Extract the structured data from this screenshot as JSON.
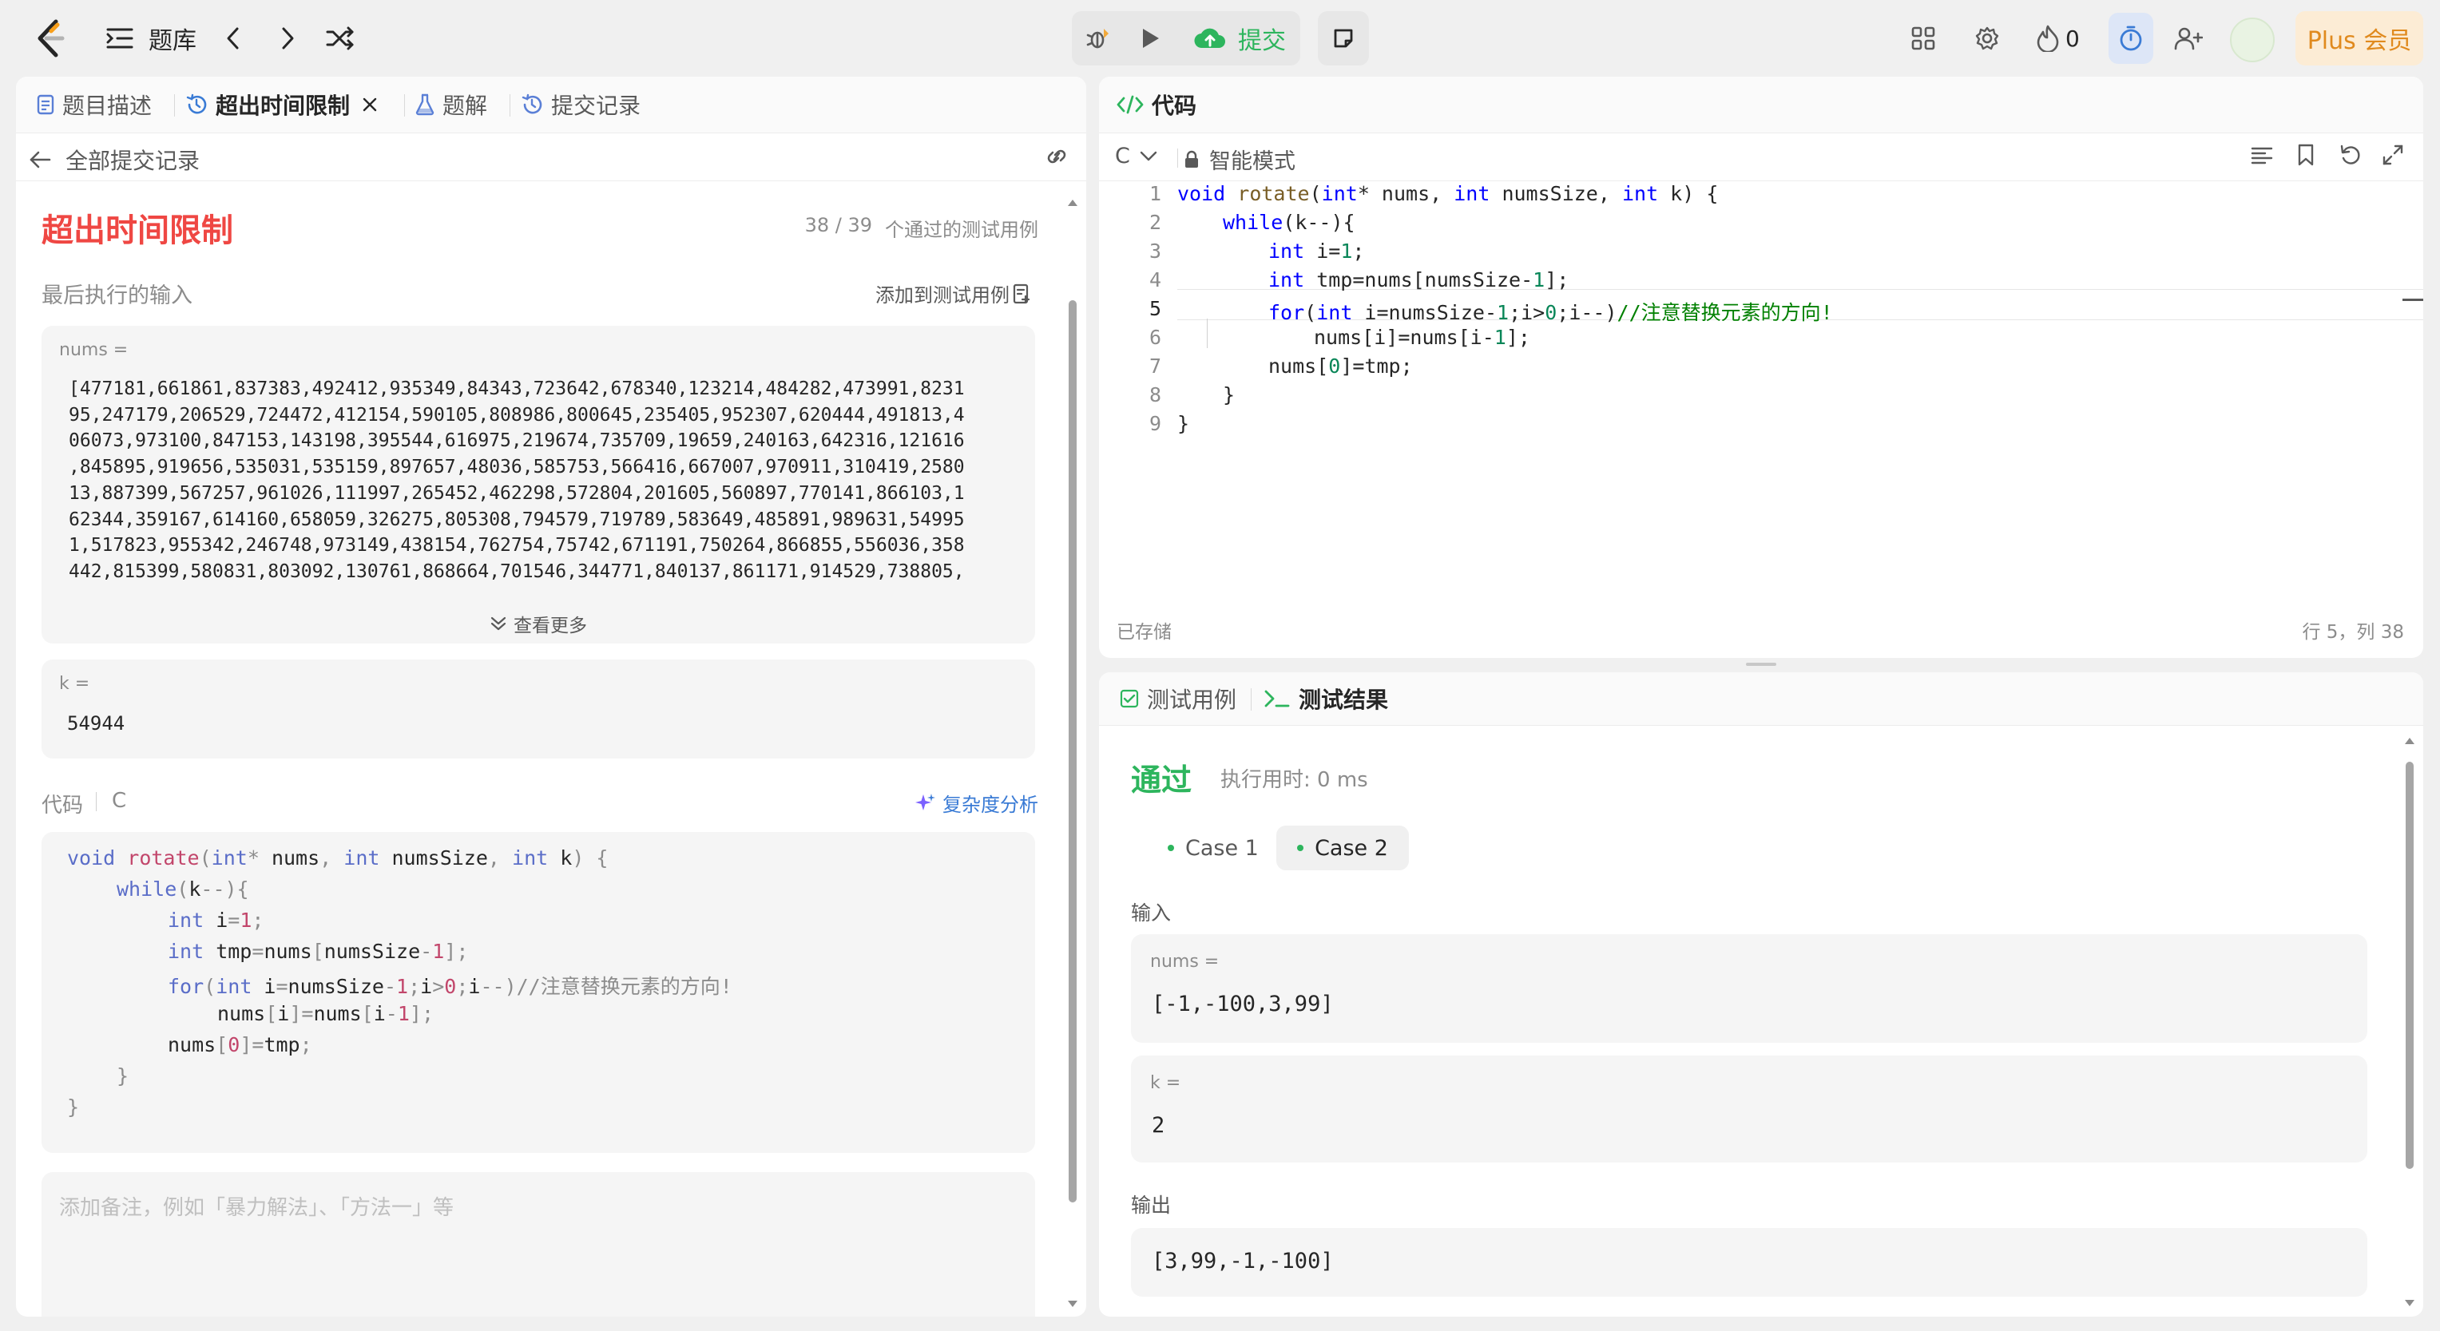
{
  "topbar": {
    "problem_bank": "题库",
    "submit_label": "提交",
    "fire_count": "0",
    "plus_label": "Plus 会员"
  },
  "left": {
    "tabs": [
      {
        "label": "题目描述"
      },
      {
        "label": "超出时间限制"
      },
      {
        "label": "题解"
      },
      {
        "label": "提交记录"
      }
    ],
    "back_label": "全部提交记录",
    "status_title": "超出时间限制",
    "testcases_passed": "38 / 39",
    "testcases_suffix": "个通过的测试用例",
    "last_input_label": "最后执行的输入",
    "add_testcase_label": "添加到测试用例",
    "nums_label": "nums =",
    "nums_lines": [
      "[477181,661861,837383,492412,935349,84343,723642,678340,123214,484282,473991,8231",
      "95,247179,206529,724472,412154,590105,808986,800645,235405,952307,620444,491813,4",
      "06073,973100,847153,143198,395544,616975,219674,735709,19659,240163,642316,121616",
      ",845895,919656,535031,535159,897657,48036,585753,566416,667007,970911,310419,2580",
      "13,887399,567257,961026,111997,265452,462298,572804,201605,560897,770141,866103,1",
      "62344,359167,614160,658059,326275,805308,794579,719789,583649,485891,989631,54995",
      "1,517823,955342,246748,973149,438154,762754,75742,671191,750264,866855,556036,358",
      "442,815399,580831,803092,130761,868664,701546,344771,840137,861171,914529,738805,"
    ],
    "show_more": "查看更多",
    "k_label": "k =",
    "k_value": "54944",
    "code_label": "代码",
    "code_lang": "C",
    "complexity_label": "复杂度分析",
    "comment_line": "//注意替换元素的方向!",
    "note_placeholder": "添加备注，例如「暴力解法」、「方法一」等"
  },
  "editor": {
    "title": "代码",
    "lang": "C",
    "mode": "智能模式",
    "line_numbers": [
      "1",
      "2",
      "3",
      "4",
      "5",
      "6",
      "7",
      "8",
      "9"
    ],
    "comment": "//注意替换元素的方向!",
    "saved": "已存储",
    "cursor_pos": "行 5，列 38"
  },
  "result": {
    "tab_testcase": "测试用例",
    "tab_result": "测试结果",
    "status": "通过",
    "runtime": "执行用时: 0 ms",
    "cases": [
      {
        "label": "Case 1"
      },
      {
        "label": "Case 2"
      }
    ],
    "input_label": "输入",
    "nums_label": "nums =",
    "nums_value": "[-1,-100,3,99]",
    "k_label": "k =",
    "k_value": "2",
    "output_label": "输出",
    "output_value": "[3,99,-1,-100]"
  },
  "colors": {
    "accent_blue": "#3a7bd5",
    "success_green": "#2db55d",
    "error_red": "#ef4743",
    "plus_orange": "#e08a1e"
  }
}
